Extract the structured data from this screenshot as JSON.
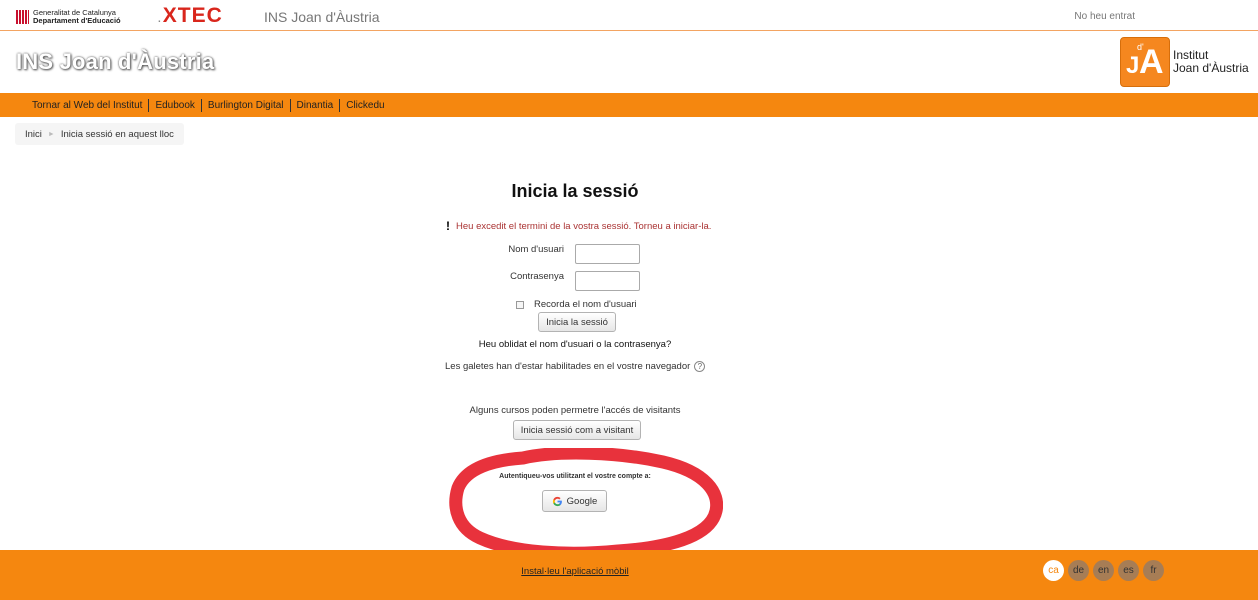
{
  "topbar": {
    "gencat_line1": "Generalitat de Catalunya",
    "gencat_line2": "Departament d'Educació",
    "xtec_label": "XTEC",
    "site_name": "INS Joan d'Àustria",
    "login_info": "No heu entrat"
  },
  "header": {
    "site_title": "INS Joan d'Àustria",
    "logo_line1": "Institut",
    "logo_line2": "Joan d'Àustria",
    "logo_letters": {
      "j": "J",
      "d": "d'",
      "a": "A"
    }
  },
  "nav": {
    "items": [
      "Tornar al Web del Institut",
      "Edubook",
      "Burlington Digital",
      "Dinantia",
      "Clickedu"
    ]
  },
  "breadcrumb": {
    "home": "Inici",
    "separator": "►",
    "current": "Inicia sessió en aquest lloc"
  },
  "login": {
    "title": "Inicia la sessió",
    "error_icon": "!",
    "error_message": "Heu excedit el termini de la vostra sessió. Torneu a iniciar-la.",
    "username_label": "Nom d'usuari",
    "username_value": "",
    "password_label": "Contrasenya",
    "password_value": "",
    "remember_label": "Recorda el nom d'usuari",
    "remember_checked": false,
    "submit_label": "Inicia la sessió",
    "forgot_label": "Heu oblidat el nom d'usuari o la contrasenya?",
    "cookies_text": "Les galetes han d'estar habilitades en el vostre navegador",
    "help_icon": "?",
    "guest_text": "Alguns cursos poden permetre l'accés de visitants",
    "guest_button": "Inicia sessió com a visitant",
    "auth_text": "Autentiqueu-vos utilitzant el vostre compte a:",
    "google_button": "Google"
  },
  "annotation": {
    "color": "#e8323c"
  },
  "footer": {
    "app_link": "Instal·leu l'aplicació mòbil",
    "languages": [
      "ca",
      "de",
      "en",
      "es",
      "fr"
    ],
    "active_language": "ca"
  },
  "colors": {
    "accent": "#f5870f",
    "error": "#aa3333"
  }
}
